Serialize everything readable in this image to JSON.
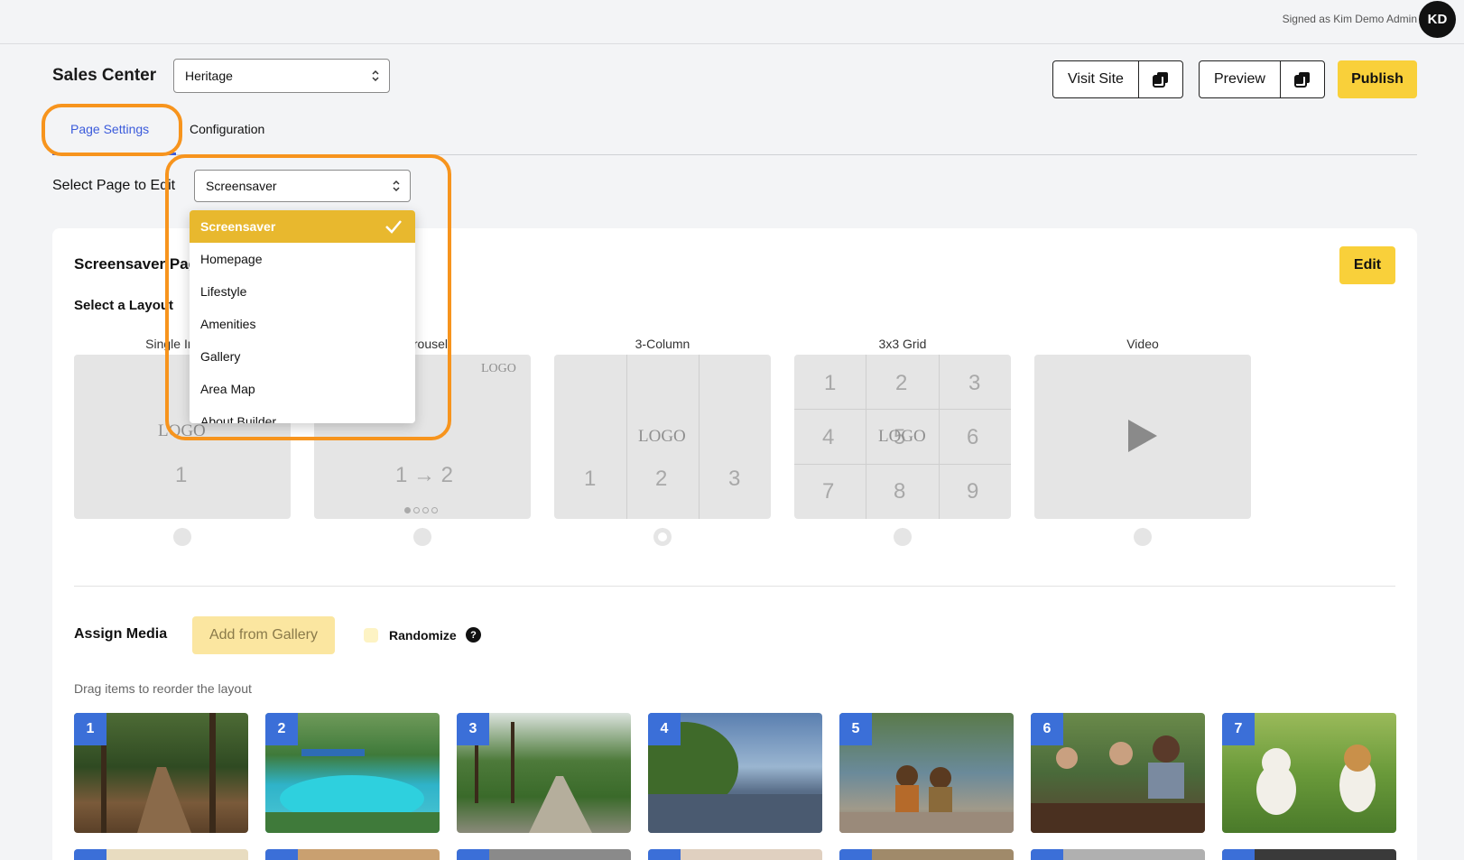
{
  "user": {
    "signed_as": "Signed as Kim Demo Admin",
    "initials": "KD"
  },
  "header": {
    "title": "Sales Center",
    "site_select_value": "Heritage",
    "visit_site_label": "Visit Site",
    "preview_label": "Preview",
    "publish_label": "Publish"
  },
  "tabs": [
    {
      "label": "Page Settings",
      "active": true
    },
    {
      "label": "Configuration",
      "active": false
    }
  ],
  "page_select": {
    "label": "Select Page to Edit",
    "value": "Screensaver",
    "options": [
      "Screensaver",
      "Homepage",
      "Lifestyle",
      "Amenities",
      "Gallery",
      "Area Map",
      "About Builder"
    ]
  },
  "card": {
    "title": "Screensaver Page",
    "edit_label": "Edit",
    "layout_label": "Select a Layout",
    "layouts": [
      {
        "name": "Single Image",
        "selected": false
      },
      {
        "name": "Carousel",
        "selected": false
      },
      {
        "name": "3-Column",
        "selected": true
      },
      {
        "name": "3x3 Grid",
        "selected": false
      },
      {
        "name": "Video",
        "selected": false
      }
    ],
    "logo_text": "LOGO",
    "carousel_caption": "1 → 2",
    "assign_media_label": "Assign Media",
    "add_from_gallery_label": "Add from Gallery",
    "randomize_label": "Randomize",
    "help_glyph": "?",
    "drag_hint": "Drag items to reorder the layout",
    "media": [
      {
        "index": "1"
      },
      {
        "index": "2"
      },
      {
        "index": "3"
      },
      {
        "index": "4"
      },
      {
        "index": "5"
      },
      {
        "index": "6"
      },
      {
        "index": "7"
      }
    ]
  },
  "colors": {
    "accent_yellow": "#f9d03a",
    "tab_blue": "#3b5bdb",
    "highlight_orange": "#f7941d",
    "badge_blue": "#3b6fd8"
  }
}
